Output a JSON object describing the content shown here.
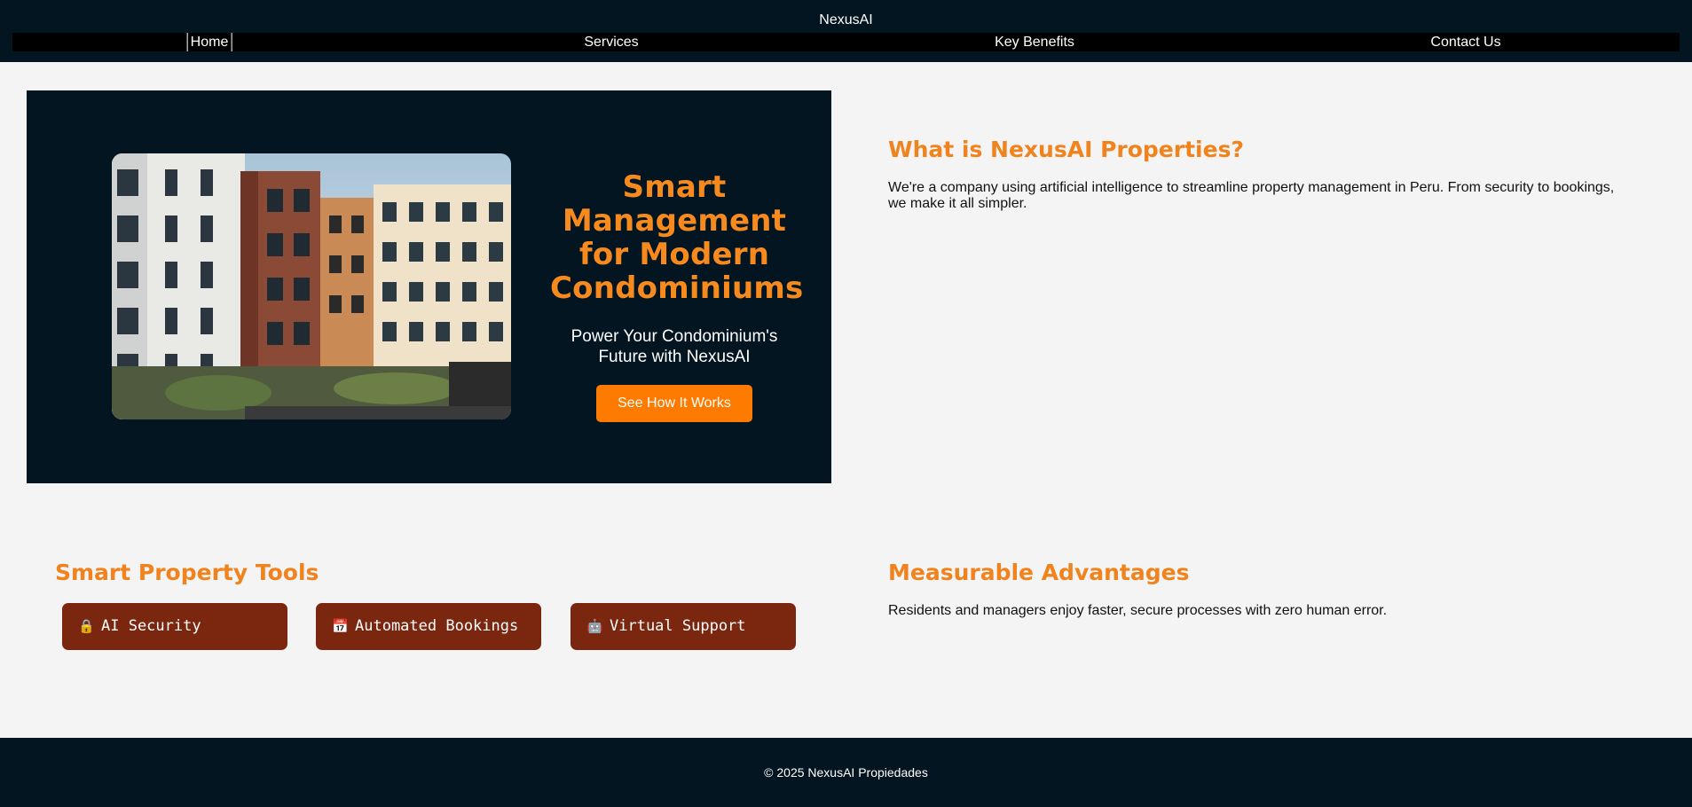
{
  "header": {
    "brand": "NexusAI",
    "nav": [
      {
        "label": "Home"
      },
      {
        "label": "Services"
      },
      {
        "label": "Key Benefits"
      },
      {
        "label": "Contact Us"
      }
    ]
  },
  "hero": {
    "title": "Smart Management for Modern Condominiums",
    "subtitle": "Power Your Condominium's Future with NexusAI",
    "cta": "See How It Works",
    "image": "condominium-building-photo"
  },
  "about": {
    "title": "What is NexusAI Properties?",
    "text": "We're a company using artificial intelligence to streamline property management in Peru. From security to bookings, we make it all simpler."
  },
  "tools": {
    "title": "Smart Property Tools",
    "items": [
      {
        "icon": "🔒",
        "icon_name": "lock-icon",
        "label": "AI Security"
      },
      {
        "icon": "📅",
        "icon_name": "calendar-icon",
        "label": "Automated Bookings"
      },
      {
        "icon": "🤖",
        "icon_name": "robot-icon",
        "label": "Virtual Support"
      }
    ]
  },
  "advantages": {
    "title": "Measurable Advantages",
    "text": "Residents and managers enjoy faster, secure processes with zero human error."
  },
  "footer": {
    "text": "© 2025 NexusAI Propiedades"
  },
  "colors": {
    "dark": "#031521",
    "accent": "#f68a1f",
    "button": "#ff7b00",
    "tool_bg": "#7b2710",
    "page_bg": "#f4f4f4"
  }
}
